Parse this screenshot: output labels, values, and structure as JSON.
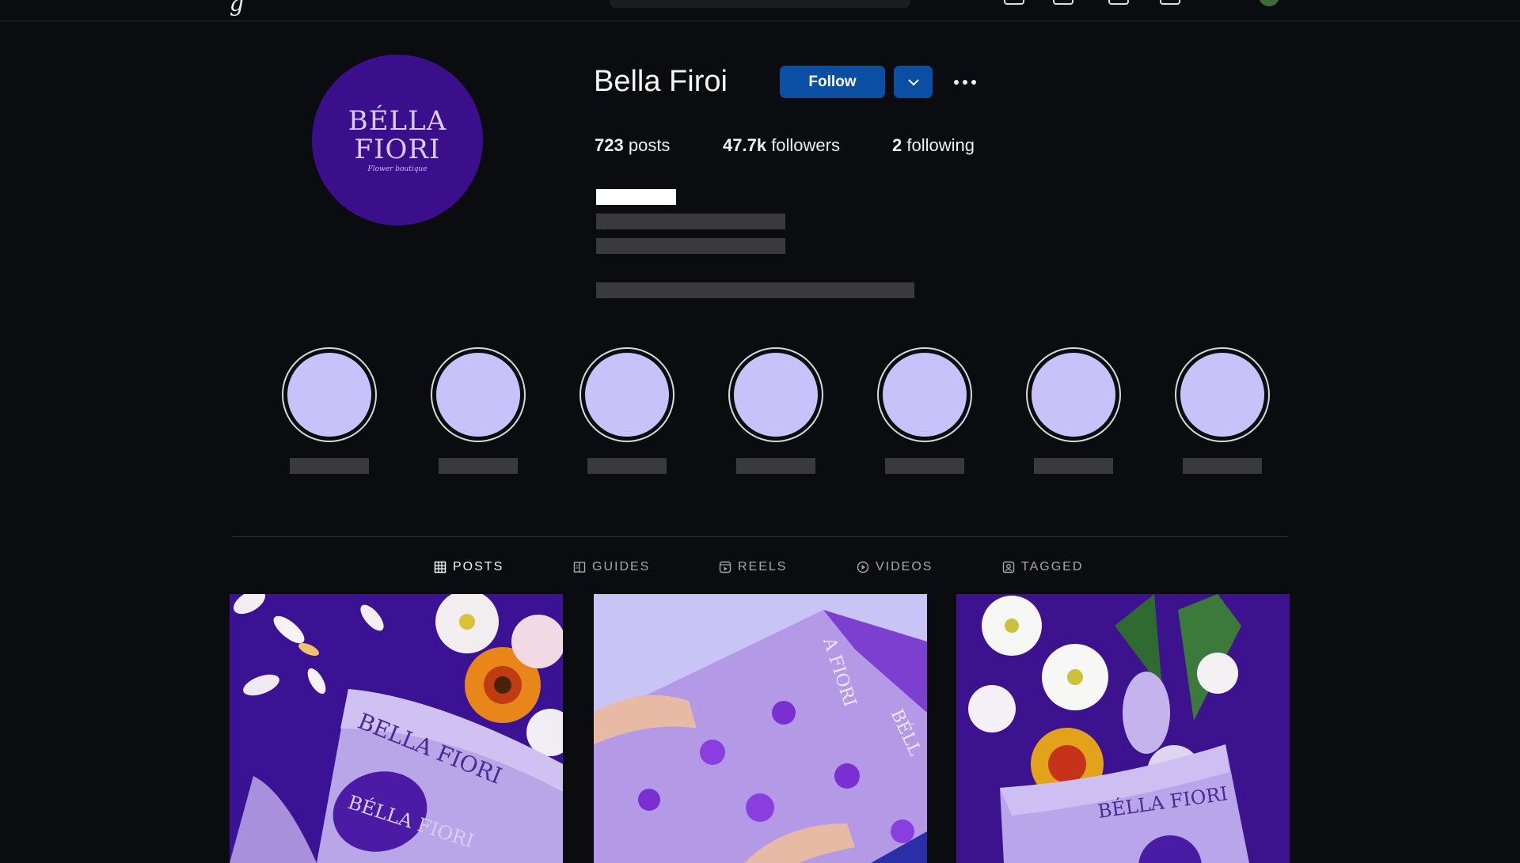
{
  "topbar": {
    "logo_fragment": "g"
  },
  "profile": {
    "avatar_line1": "BÉLLA",
    "avatar_line2": "FIORI",
    "avatar_signature": "Flower boutique",
    "username": "Bella Firoi",
    "follow_label": "Follow",
    "stats": {
      "posts_count": "723",
      "posts_label": "posts",
      "followers_count": "47.7k",
      "followers_label": "followers",
      "following_count": "2",
      "following_label": "following"
    }
  },
  "highlights": [
    {
      "color": "#c7c2fa"
    },
    {
      "color": "#c7c2fa"
    },
    {
      "color": "#c7c2fa"
    },
    {
      "color": "#c7c2fa"
    },
    {
      "color": "#c7c2fa"
    },
    {
      "color": "#c7c2fa"
    },
    {
      "color": "#c7c2fa"
    }
  ],
  "tabs": [
    {
      "label": "POSTS",
      "icon": "grid-icon",
      "active": true
    },
    {
      "label": "GUIDES",
      "icon": "guide-icon",
      "active": false
    },
    {
      "label": "REELS",
      "icon": "reels-icon",
      "active": false
    },
    {
      "label": "VIDEOS",
      "icon": "play-icon",
      "active": false
    },
    {
      "label": "TAGGED",
      "icon": "tag-icon",
      "active": false
    }
  ],
  "posts": [
    {
      "wrap_text": "BELLA FIORI",
      "sticker_text": "BÉLLA FIORI"
    },
    {
      "wrap_text": "A FIORI",
      "side_text": "BÉLL"
    },
    {
      "wrap_text": "BÉLLA FIORI"
    }
  ],
  "colors": {
    "background": "#0b0c0f",
    "accent_button": "#0a4fa3",
    "brand_purple": "#3b0f8c",
    "highlight_fill": "#c7c2fa",
    "redaction": "#3a3a3c"
  }
}
